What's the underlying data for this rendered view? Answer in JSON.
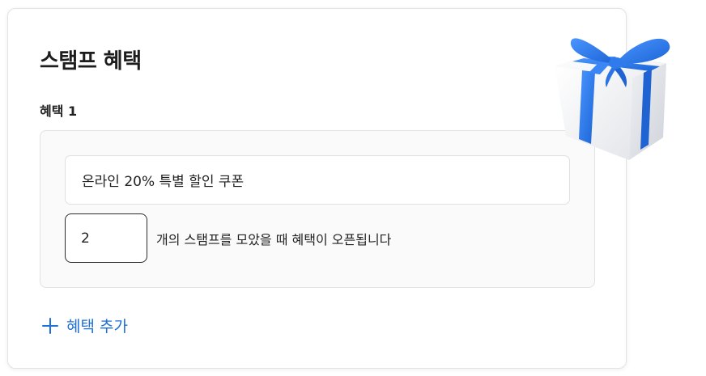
{
  "section": {
    "title": "스탬프 혜택"
  },
  "benefits": [
    {
      "label": "혜택 1",
      "name_value": "온라인 20% 특별 할인 쿠폰",
      "stamp_count": "2",
      "count_suffix": "개의 스탬프를 모았을 때 혜택이 오픈됩니다"
    }
  ],
  "add_button": {
    "label": "혜택 추가",
    "icon": "plus-icon"
  },
  "decoration": {
    "icon": "gift-icon"
  },
  "colors": {
    "accent": "#1f6fd8",
    "ribbon": "#2b7ff0",
    "card_border": "#e3e3e3",
    "box_background": "#fafafa"
  }
}
